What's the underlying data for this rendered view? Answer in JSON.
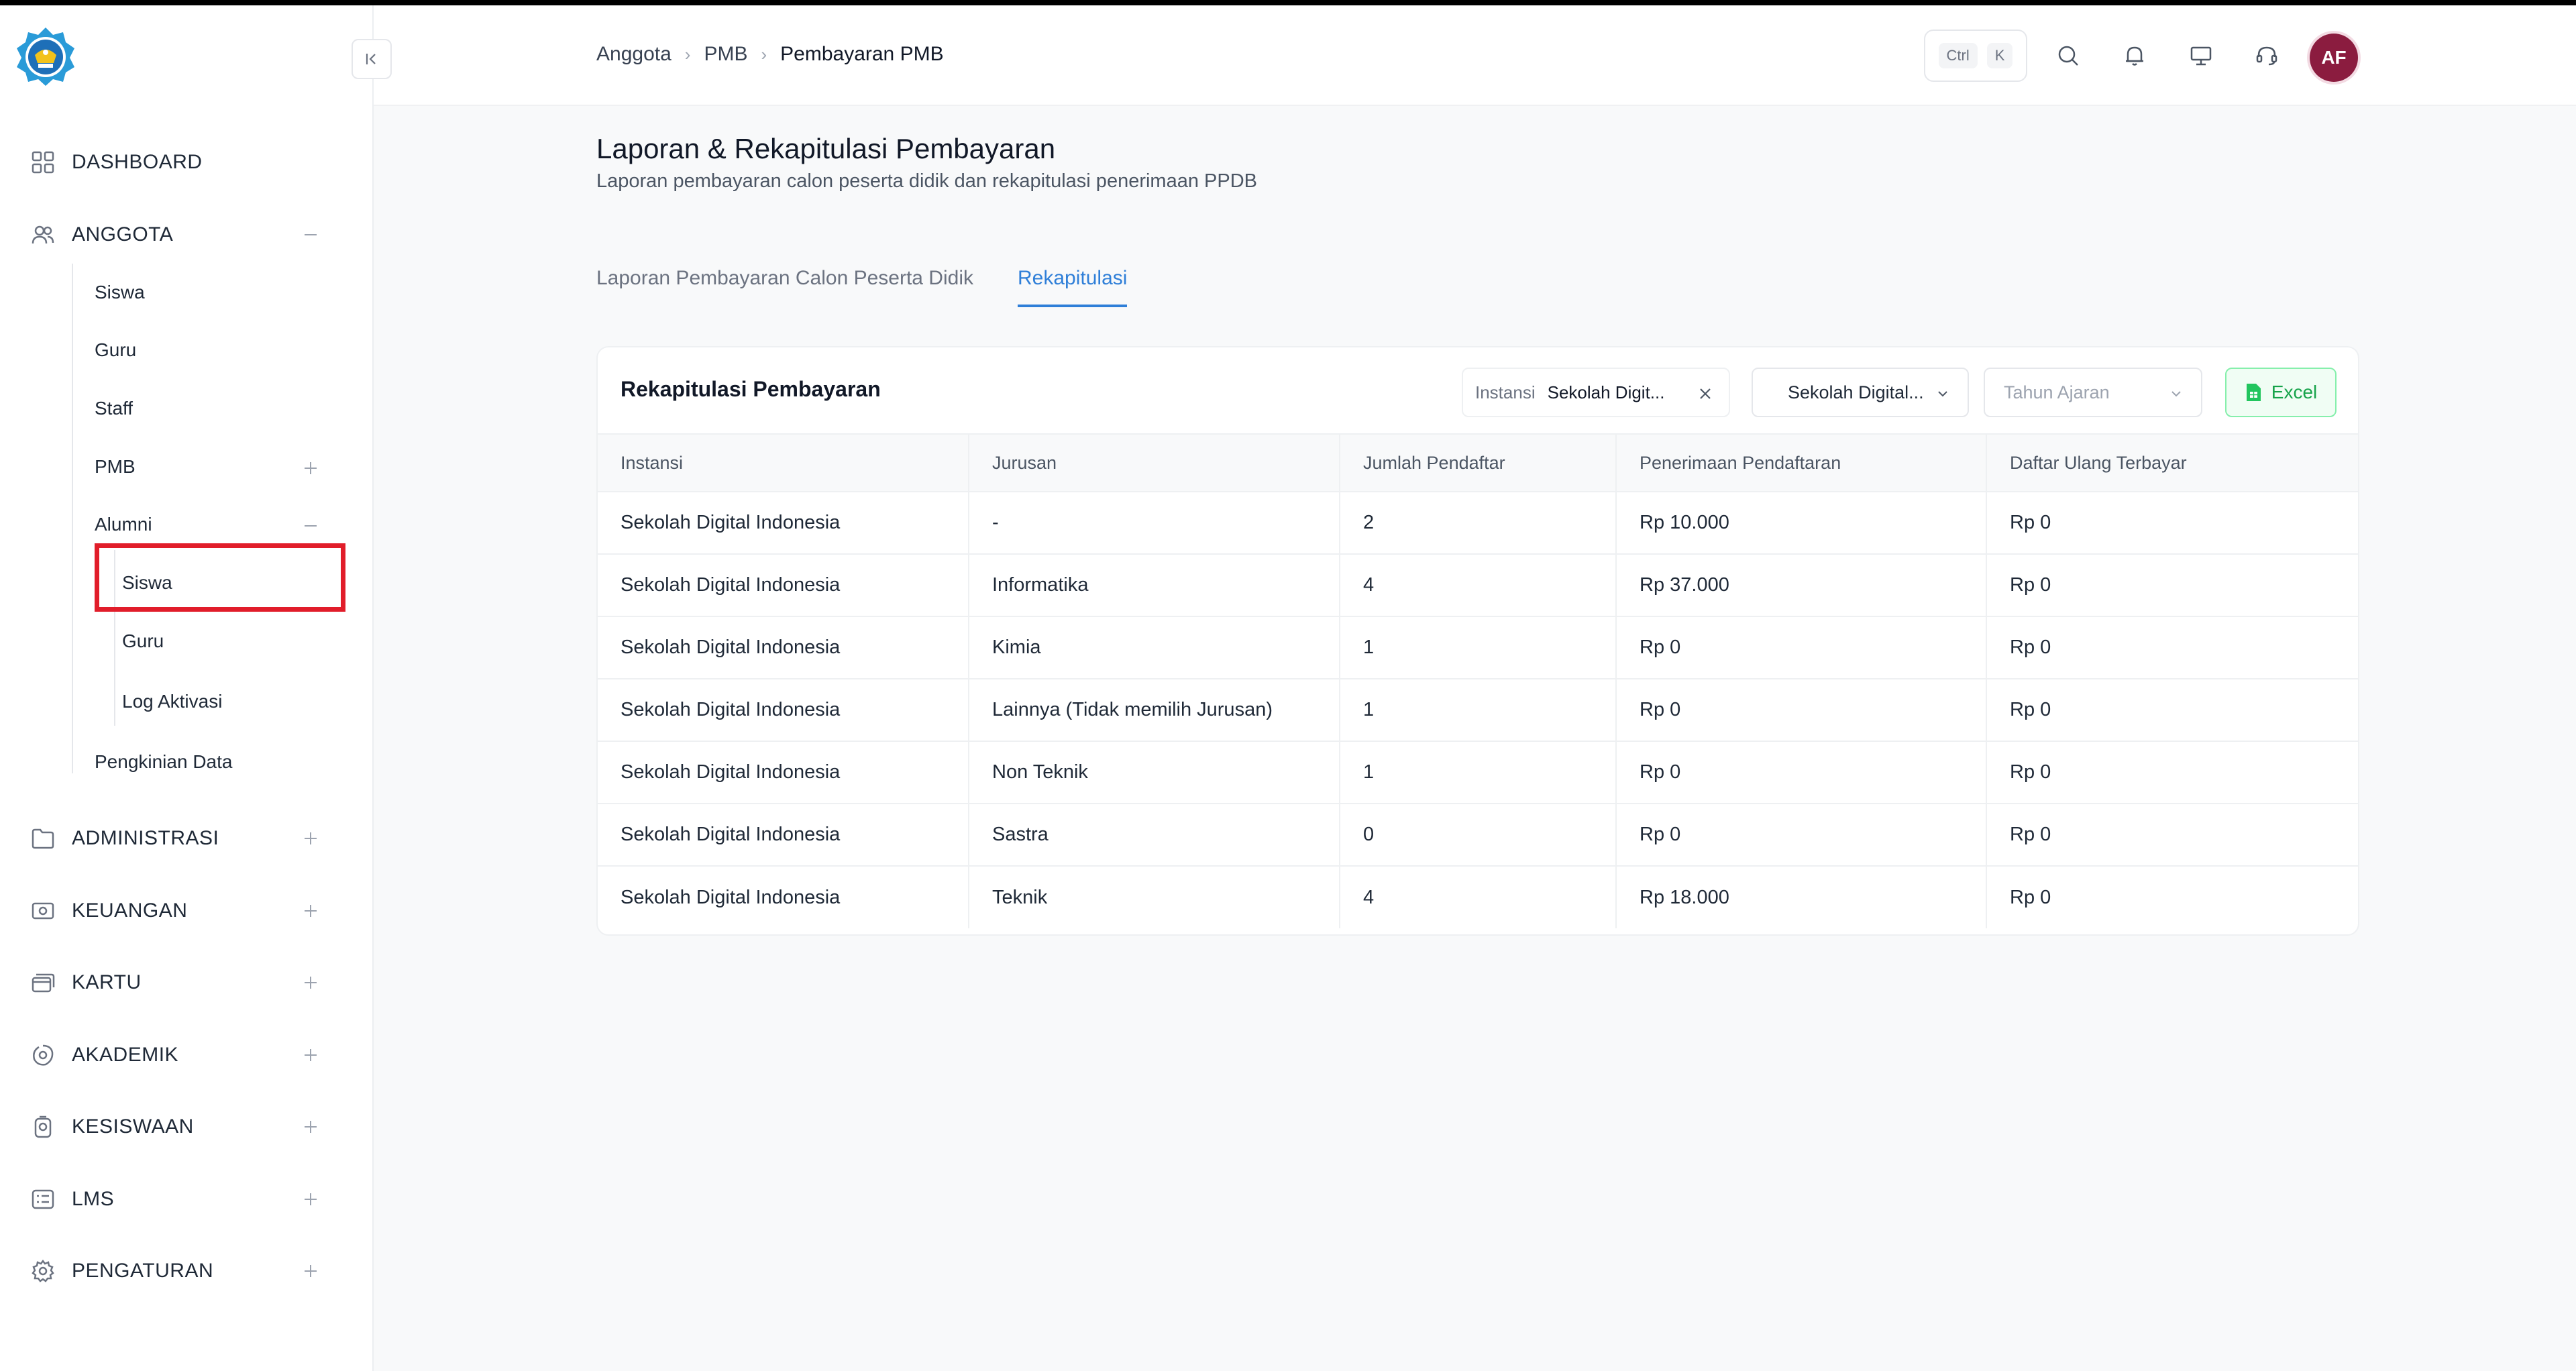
{
  "sidebar": {
    "logo_name": "tut-wuri-handayani-logo",
    "nav": [
      {
        "label": "DASHBOARD",
        "icon": "grid-icon"
      },
      {
        "label": "ANGGOTA",
        "icon": "users-icon",
        "toggle": "minus-icon"
      },
      {
        "label": "ADMINISTRASI",
        "icon": "folder-icon",
        "toggle": "plus-icon"
      },
      {
        "label": "KEUANGAN",
        "icon": "money-icon",
        "toggle": "plus-icon"
      },
      {
        "label": "KARTU",
        "icon": "cards-icon",
        "toggle": "plus-icon"
      },
      {
        "label": "AKADEMIK",
        "icon": "academic-icon",
        "toggle": "plus-icon"
      },
      {
        "label": "KESISWAAN",
        "icon": "student-icon",
        "toggle": "plus-icon"
      },
      {
        "label": "LMS",
        "icon": "list-icon",
        "toggle": "plus-icon"
      },
      {
        "label": "PENGATURAN",
        "icon": "gear-icon",
        "toggle": "plus-icon"
      }
    ],
    "anggota_sub": [
      {
        "label": "Siswa"
      },
      {
        "label": "Guru"
      },
      {
        "label": "Staff"
      },
      {
        "label": "PMB"
      },
      {
        "label": "Alumni"
      }
    ],
    "alumni_sub": [
      {
        "label": "Siswa"
      },
      {
        "label": "Guru"
      },
      {
        "label": "Log Aktivasi"
      }
    ],
    "pengkinian": "Pengkinian Data"
  },
  "topbar": {
    "breadcrumb": [
      "Anggota",
      "PMB",
      "Pembayaran PMB"
    ],
    "kbd": [
      "Ctrl",
      "K"
    ],
    "avatar": "AF"
  },
  "page": {
    "title": "Laporan & Rekapitulasi Pembayaran",
    "subtitle": "Laporan pembayaran calon peserta didik dan rekapitulasi penerimaan PPDB",
    "tabs": [
      "Laporan Pembayaran Calon Peserta Didik",
      "Rekapitulasi"
    ],
    "active_tab": 1
  },
  "card": {
    "title": "Rekapitulasi Pembayaran",
    "filter_key": "Instansi",
    "filter_value": "Sekolah Digit...",
    "select_school": "Sekolah Digital...",
    "select_year_placeholder": "Tahun Ajaran",
    "excel_label": "Excel",
    "columns": [
      "Instansi",
      "Jurusan",
      "Jumlah Pendaftar",
      "Penerimaan Pendaftaran",
      "Daftar Ulang Terbayar"
    ],
    "rows": [
      [
        "Sekolah Digital Indonesia",
        "-",
        "2",
        "Rp 10.000",
        "Rp 0"
      ],
      [
        "Sekolah Digital Indonesia",
        "Informatika",
        "4",
        "Rp 37.000",
        "Rp 0"
      ],
      [
        "Sekolah Digital Indonesia",
        "Kimia",
        "1",
        "Rp 0",
        "Rp 0"
      ],
      [
        "Sekolah Digital Indonesia",
        "Lainnya (Tidak memilih Jurusan)",
        "1",
        "Rp 0",
        "Rp 0"
      ],
      [
        "Sekolah Digital Indonesia",
        "Non Teknik",
        "1",
        "Rp 0",
        "Rp 0"
      ],
      [
        "Sekolah Digital Indonesia",
        "Sastra",
        "0",
        "Rp 0",
        "Rp 0"
      ],
      [
        "Sekolah Digital Indonesia",
        "Teknik",
        "4",
        "Rp 18.000",
        "Rp 0"
      ]
    ]
  },
  "colors": {
    "accent": "#2f7fd8",
    "highlight": "#e11d2a",
    "excel_green": "#16a34a",
    "avatar_bg": "#8b1c3f"
  }
}
